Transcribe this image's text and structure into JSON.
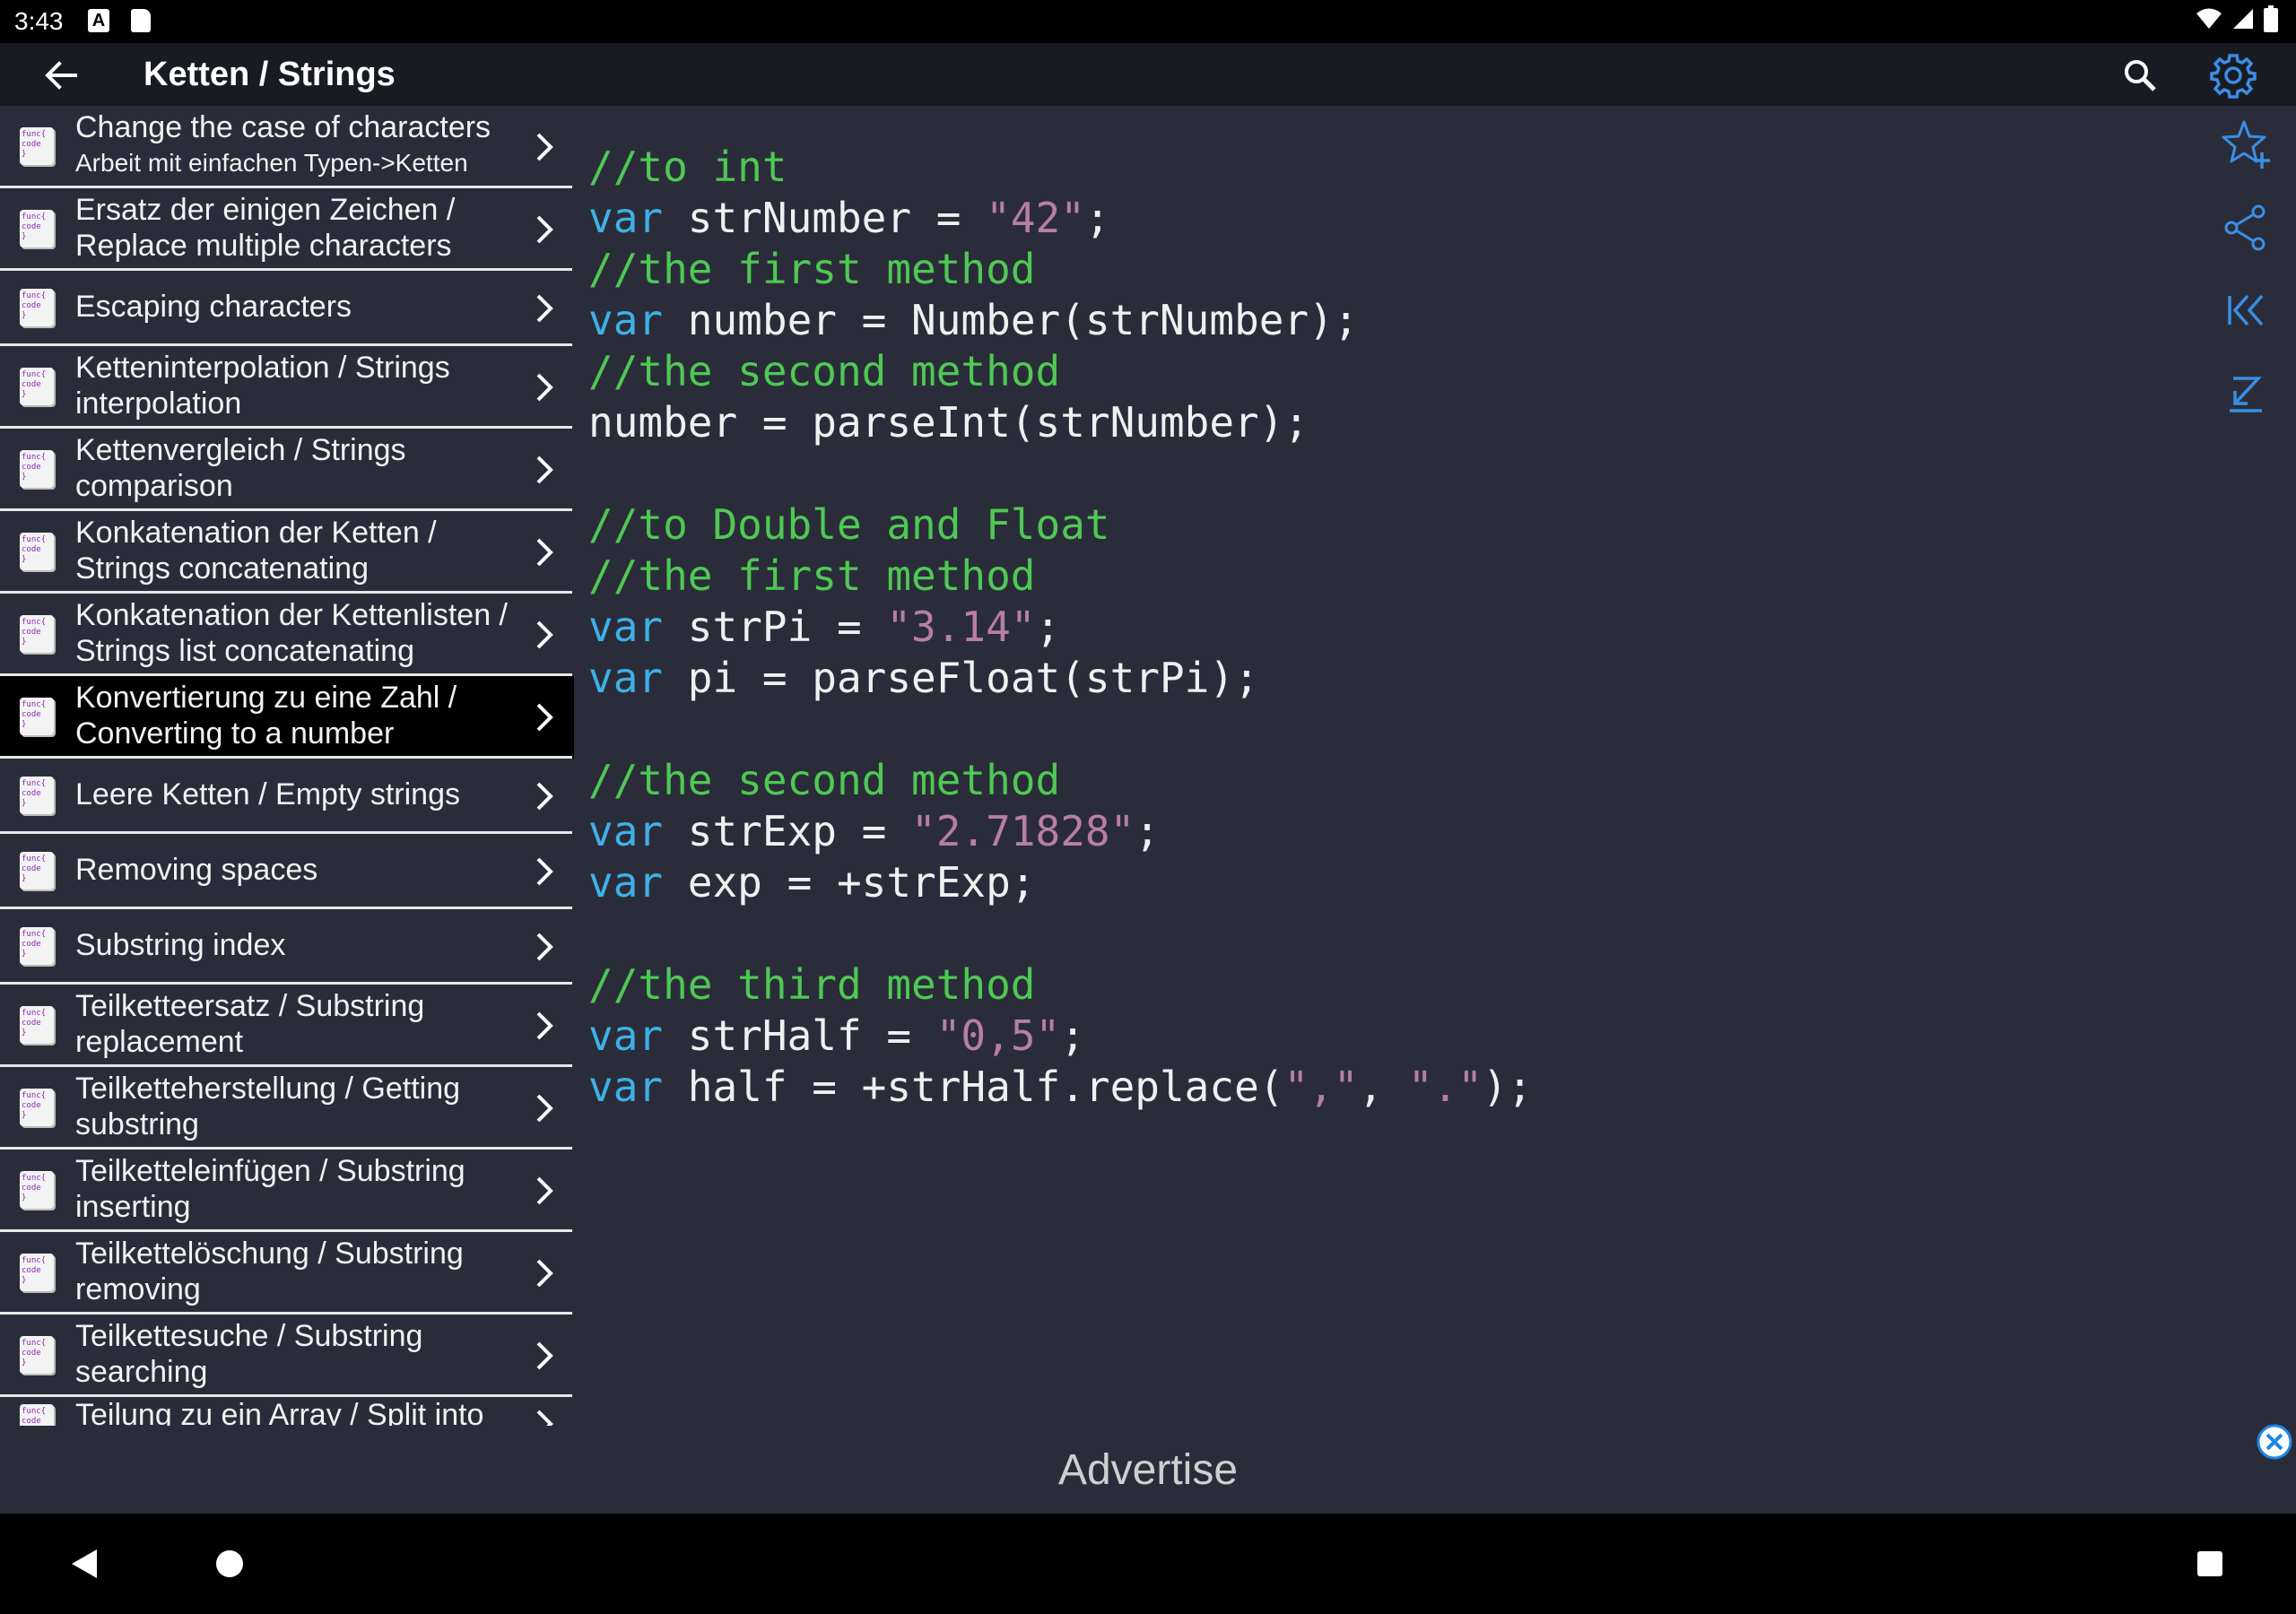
{
  "status": {
    "time": "3:43",
    "icons": [
      "a-icon",
      "sd-card-icon",
      "wifi-icon",
      "signal-icon",
      "battery-icon"
    ]
  },
  "appbar": {
    "title": "Ketten / Strings"
  },
  "list": [
    {
      "title": "Change the case of characters",
      "subtitle": "Arbeit mit einfachen Typen->Ketten"
    },
    {
      "title": "Ersatz der einigen Zeichen / Replace multiple characters"
    },
    {
      "title": "Escaping characters"
    },
    {
      "title": "Ketteninterpolation / Strings interpolation"
    },
    {
      "title": "Kettenvergleich / Strings comparison"
    },
    {
      "title": "Konkatenation der Ketten / Strings concatenating"
    },
    {
      "title": "Konkatenation der Kettenlisten / Strings list concatenating"
    },
    {
      "title": "Konvertierung zu eine Zahl / Converting to a number"
    },
    {
      "title": "Leere Ketten / Empty strings"
    },
    {
      "title": "Removing spaces"
    },
    {
      "title": "Substring index"
    },
    {
      "title": "Teilketteersatz  / Substring replacement"
    },
    {
      "title": "Teilketteherstellung / Getting substring"
    },
    {
      "title": "Teilketteleinfügen / Substring inserting"
    },
    {
      "title": "Teilkettelöschung / Substring removing"
    },
    {
      "title": "Teilkettesuche / Substring searching"
    },
    {
      "title": "Teilung zu ein Array / Split into an"
    }
  ],
  "list_icon_text": [
    "func{",
    "code",
    "}"
  ],
  "active_index": 7,
  "code": [
    [
      [
        "cm",
        "//to int"
      ]
    ],
    [
      [
        "kw",
        "var"
      ],
      [
        "pl",
        " strNumber = "
      ],
      [
        "st",
        "\"42\""
      ],
      [
        "pl",
        ";"
      ]
    ],
    [
      [
        "cm",
        "//the first method"
      ]
    ],
    [
      [
        "kw",
        "var"
      ],
      [
        "pl",
        " number = Number(strNumber);"
      ]
    ],
    [
      [
        "cm",
        "//the second method"
      ]
    ],
    [
      [
        "pl",
        "number = parseInt(strNumber);"
      ]
    ],
    [],
    [
      [
        "cm",
        "//to Double and Float"
      ]
    ],
    [
      [
        "cm",
        "//the first method"
      ]
    ],
    [
      [
        "kw",
        "var"
      ],
      [
        "pl",
        " strPi = "
      ],
      [
        "st",
        "\"3.14\""
      ],
      [
        "pl",
        ";"
      ]
    ],
    [
      [
        "kw",
        "var"
      ],
      [
        "pl",
        " pi = parseFloat(strPi);"
      ]
    ],
    [],
    [
      [
        "cm",
        "//the second method"
      ]
    ],
    [
      [
        "kw",
        "var"
      ],
      [
        "pl",
        " strExp = "
      ],
      [
        "st",
        "\"2.71828\""
      ],
      [
        "pl",
        ";"
      ]
    ],
    [
      [
        "kw",
        "var"
      ],
      [
        "pl",
        " exp = +strExp;"
      ]
    ],
    [],
    [
      [
        "cm",
        "//the third method"
      ]
    ],
    [
      [
        "kw",
        "var"
      ],
      [
        "pl",
        " strHalf = "
      ],
      [
        "st",
        "\"0,5\""
      ],
      [
        "pl",
        ";"
      ]
    ],
    [
      [
        "kw",
        "var"
      ],
      [
        "pl",
        " half = +strHalf.replace("
      ],
      [
        "st",
        "\",\""
      ],
      [
        "pl",
        ", "
      ],
      [
        "st",
        "\".\""
      ],
      [
        "pl",
        ");"
      ]
    ]
  ],
  "right_toolbar": [
    "star-add-icon",
    "share-icon",
    "first-page-icon",
    "scroll-bottom-icon"
  ],
  "ad": {
    "label": "Advertise"
  },
  "colors": {
    "background": "#2a2d39",
    "comment": "#4fc854",
    "keyword": "#3fb0e8",
    "string": "#b77fa0",
    "accent": "#3a8ee6"
  }
}
